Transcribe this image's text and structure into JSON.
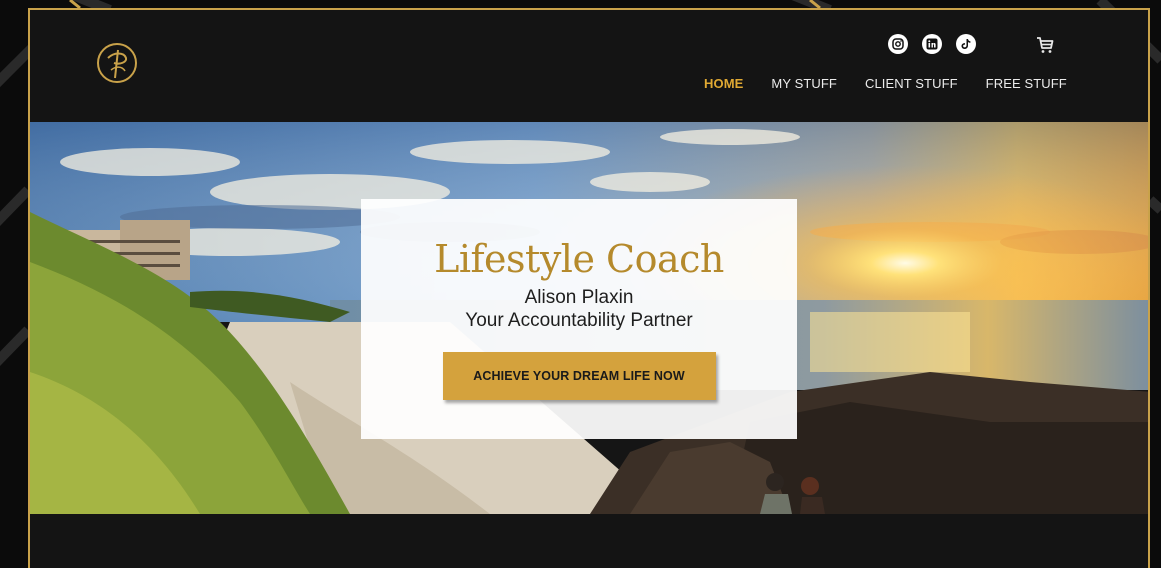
{
  "header": {
    "logo": {
      "icon": "signature-monogram-logo",
      "accent": "#c9a24a"
    },
    "social": [
      {
        "name": "instagram-icon"
      },
      {
        "name": "linkedin-icon"
      },
      {
        "name": "tiktok-icon"
      }
    ],
    "cart_icon": "cart-icon",
    "nav": [
      {
        "label": "HOME",
        "active": true
      },
      {
        "label": "MY STUFF",
        "active": false
      },
      {
        "label": "CLIENT STUFF",
        "active": false
      },
      {
        "label": "FREE STUFF",
        "active": false
      }
    ]
  },
  "hero": {
    "title": "Lifestyle Coach",
    "name": "Alison Plaxin",
    "tagline": "Your Accountability Partner",
    "cta_label": "ACHIEVE YOUR DREAM LIFE NOW"
  },
  "colors": {
    "accent_gold": "#d4a23d",
    "nav_active": "#e0a933",
    "background": "#141414"
  }
}
